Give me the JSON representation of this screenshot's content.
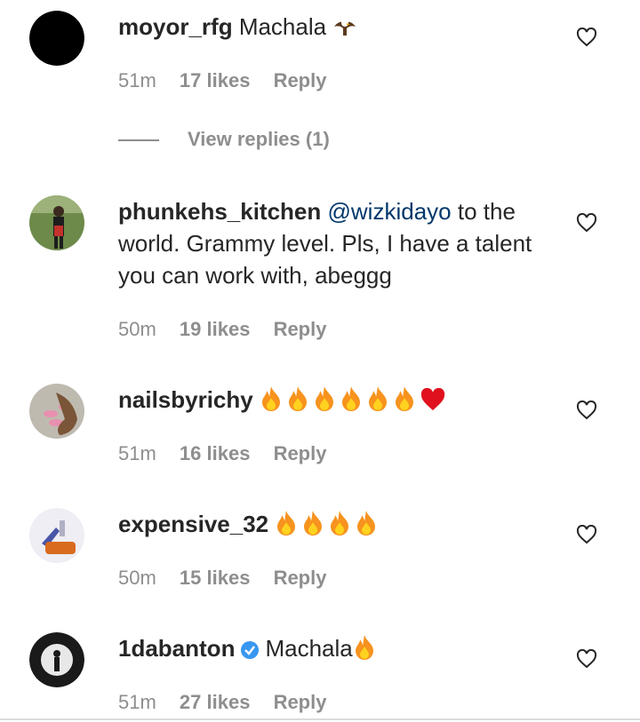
{
  "colors": {
    "text": "#262626",
    "meta": "#8e8e8e",
    "mention": "#00376b",
    "verified": "#3897f0",
    "fire": "#f7931e",
    "heart": "#e0101e"
  },
  "comments": [
    {
      "user": "moyor_rfg",
      "text_before": "Machala",
      "emoji_end": "eagle",
      "time": "51m",
      "likes": "17 likes",
      "reply": "Reply",
      "view_replies": "View replies (1)"
    },
    {
      "user": "phunkehs_kitchen",
      "mention": "@wizkidayo",
      "text": "to the world. Grammy level. Pls, I have a talent you can work with, abeggg",
      "time": "50m",
      "likes": "19 likes",
      "reply": "Reply"
    },
    {
      "user": "nailsbyrichy",
      "emojis": [
        "fire-icon",
        "fire-icon",
        "fire-icon",
        "fire-icon",
        "fire-icon",
        "fire-icon",
        "red-heart-icon"
      ],
      "time": "51m",
      "likes": "16 likes",
      "reply": "Reply"
    },
    {
      "user": "expensive_32",
      "emojis": [
        "fire-icon",
        "fire-icon",
        "fire-icon",
        "fire-icon"
      ],
      "time": "50m",
      "likes": "15 likes",
      "reply": "Reply"
    },
    {
      "user": "1dabanton",
      "verified": true,
      "text": "Machala",
      "emojis": [
        "fire-icon"
      ],
      "time": "51m",
      "likes": "27 likes",
      "reply": "Reply"
    }
  ]
}
